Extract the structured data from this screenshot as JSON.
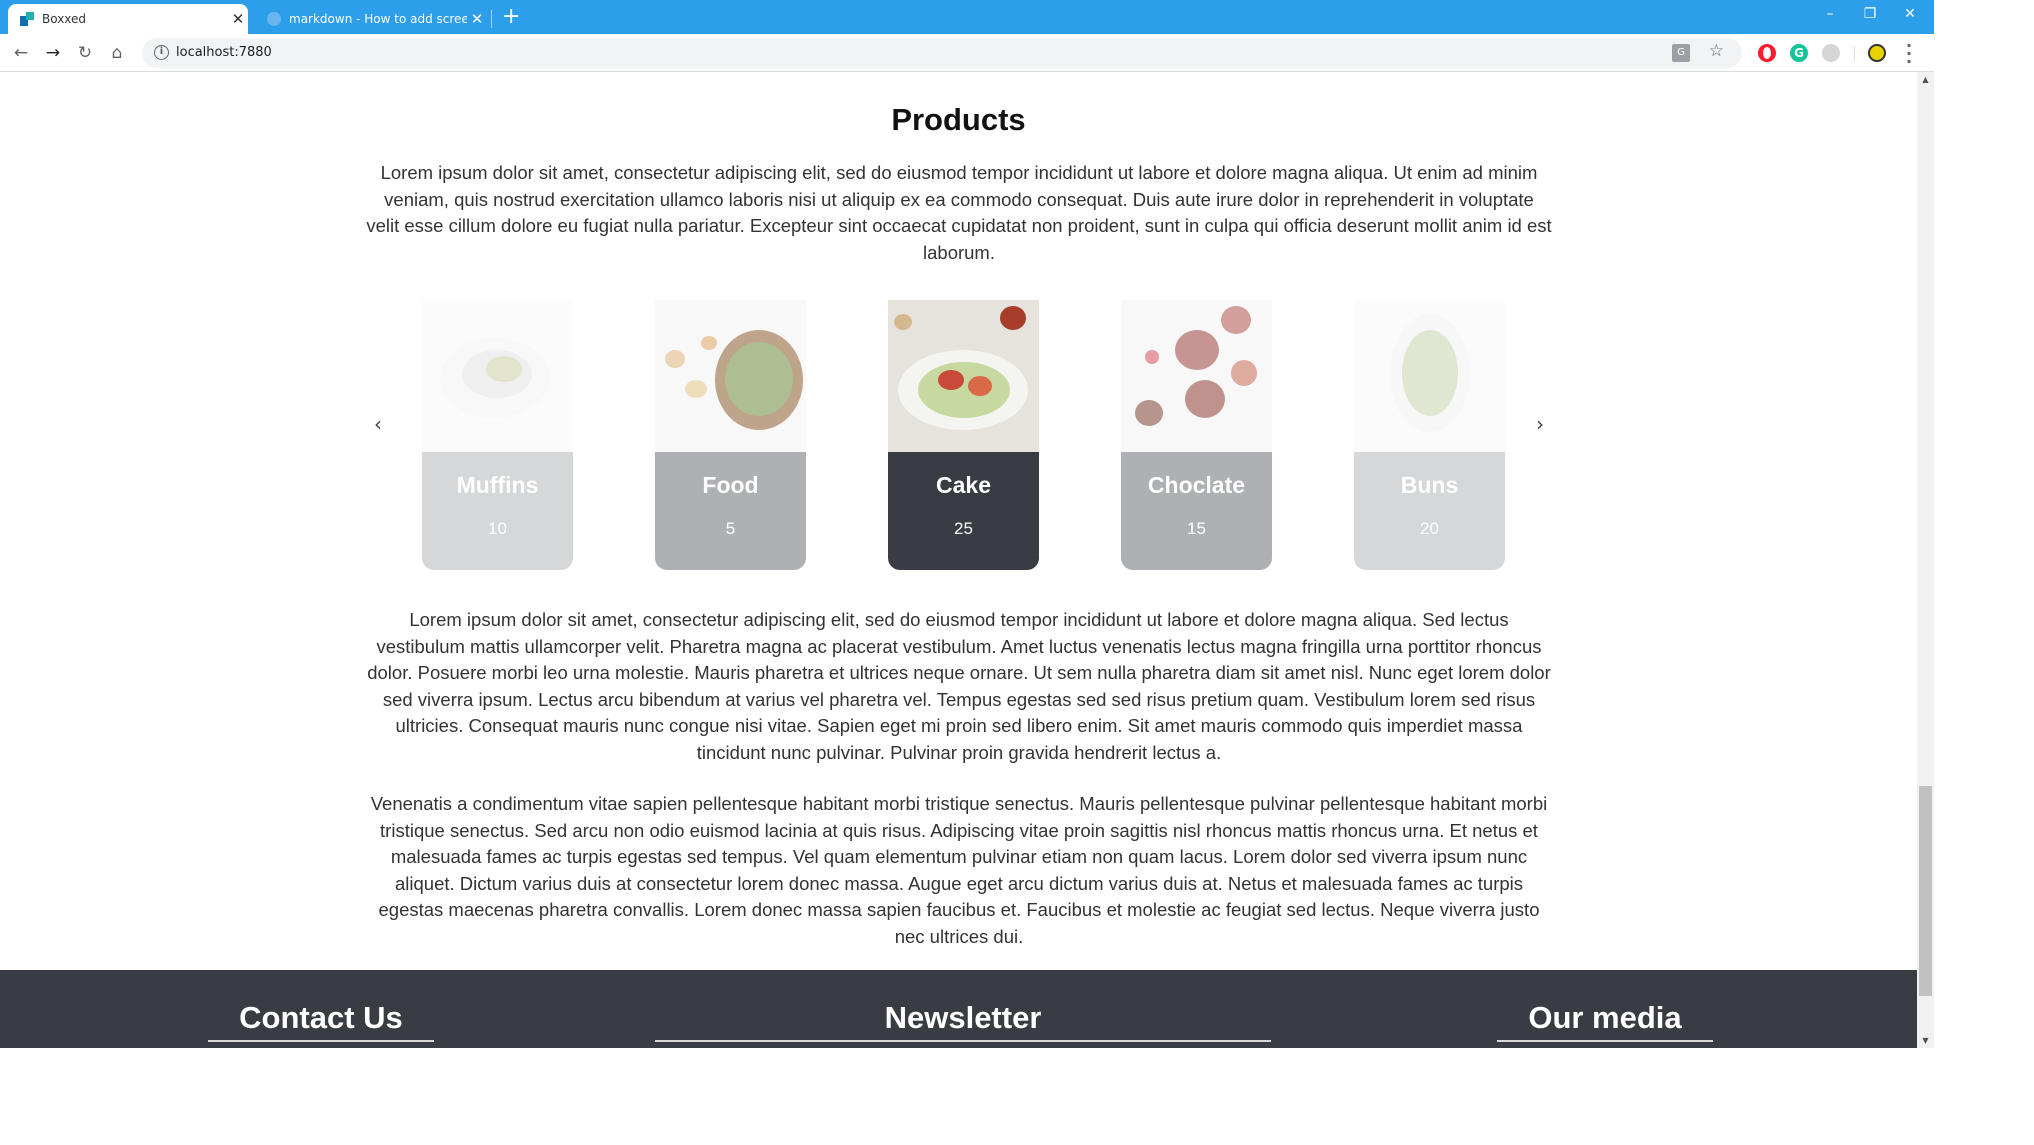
{
  "browser": {
    "tabs": [
      {
        "label": "Boxxed",
        "active": true
      },
      {
        "label": "markdown - How to add screens",
        "active": false
      }
    ],
    "url": "localhost:7880"
  },
  "page": {
    "title": "Products",
    "intro": "Lorem ipsum dolor sit amet, consectetur adipiscing elit, sed do eiusmod tempor incididunt ut labore et dolore magna aliqua. Ut enim ad minim veniam, quis nostrud exercitation ullamco laboris nisi ut aliquip ex ea commodo consequat. Duis aute irure dolor in reprehenderit in voluptate velit esse cillum dolore eu fugiat nulla pariatur. Excepteur sint occaecat cupidatat non proident, sunt in culpa qui officia deserunt mollit anim id est laborum.",
    "products": [
      {
        "name": "Muffins",
        "count": "10"
      },
      {
        "name": "Food",
        "count": "5"
      },
      {
        "name": "Cake",
        "count": "25"
      },
      {
        "name": "Choclate",
        "count": "15"
      },
      {
        "name": "Buns",
        "count": "20"
      }
    ],
    "body1": "Lorem ipsum dolor sit amet, consectetur adipiscing elit, sed do eiusmod tempor incididunt ut labore et dolore magna aliqua. Sed lectus vestibulum mattis ullamcorper velit. Pharetra magna ac placerat vestibulum. Amet luctus venenatis lectus magna fringilla urna porttitor rhoncus dolor. Posuere morbi leo urna molestie. Mauris pharetra et ultrices neque ornare. Ut sem nulla pharetra diam sit amet nisl. Nunc eget lorem dolor sed viverra ipsum. Lectus arcu bibendum at varius vel pharetra vel. Tempus egestas sed sed risus pretium quam. Vestibulum lorem sed risus ultricies. Consequat mauris nunc congue nisi vitae. Sapien eget mi proin sed libero enim. Sit amet mauris commodo quis imperdiet massa tincidunt nunc pulvinar. Pulvinar proin gravida hendrerit lectus a.",
    "body2": "Venenatis a condimentum vitae sapien pellentesque habitant morbi tristique senectus. Mauris pellentesque pulvinar pellentesque habitant morbi tristique senectus. Sed arcu non odio euismod lacinia at quis risus. Adipiscing vitae proin sagittis nisl rhoncus mattis rhoncus urna. Et netus et malesuada fames ac turpis egestas sed tempus. Vel quam elementum pulvinar etiam non quam lacus. Lorem dolor sed viverra ipsum nunc aliquet. Dictum varius duis at consectetur lorem donec massa. Augue eget arcu dictum varius duis at. Netus et malesuada fames ac turpis egestas maecenas pharetra convallis. Lorem donec massa sapien faucibus et. Faucibus et molestie ac feugiat sed lectus. Neque viverra justo nec ultrices dui."
  },
  "footer": {
    "contact": "Contact Us",
    "newsletter": "Newsletter",
    "media": "Our media"
  },
  "colors": {
    "tabbar": "#2c9eea",
    "card_dark": "#3a3c43",
    "footer": "#3a3c43"
  }
}
